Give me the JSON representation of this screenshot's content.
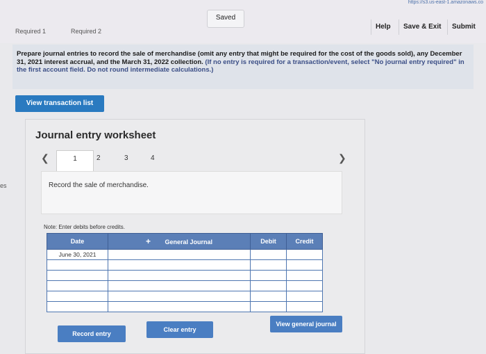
{
  "browser": {
    "url": "https://s3.us-east-1.amazonaws.co"
  },
  "header": {
    "saved_label": "Saved",
    "help_label": "Help",
    "save_exit_label": "Save & Exit",
    "submit_label": "Submit"
  },
  "tabs": [
    "Required 1",
    "Required 2"
  ],
  "prompt": {
    "instruction": "Prepare journal entries to record the sale of merchandise (omit any entry that might be required for the cost of the goods sold), any December 31, 2021 interest accrual, and the March 31, 2022 collection.",
    "hint": "(If no entry is required for a transaction/event, select \"No journal entry required\" in the first account field. Do not round intermediate calculations.)"
  },
  "view_transaction_list_label": "View transaction list",
  "side_cut_text": "es",
  "worksheet": {
    "title": "Journal entry worksheet",
    "prev_icon": "chevron-left-icon",
    "next_icon": "chevron-right-icon",
    "pages": [
      "1",
      "2",
      "3",
      "4"
    ],
    "active_page": "1",
    "description": "Record the sale of merchandise.",
    "note": "Note: Enter debits before credits.",
    "table": {
      "headers": {
        "date": "Date",
        "plus": "+",
        "account": "General Journal",
        "debit": "Debit",
        "credit": "Credit"
      },
      "rows": [
        {
          "date": "June 30, 2021",
          "account": "",
          "debit": "",
          "credit": ""
        },
        {
          "date": "",
          "account": "",
          "debit": "",
          "credit": ""
        },
        {
          "date": "",
          "account": "",
          "debit": "",
          "credit": ""
        },
        {
          "date": "",
          "account": "",
          "debit": "",
          "credit": ""
        },
        {
          "date": "",
          "account": "",
          "debit": "",
          "credit": ""
        },
        {
          "date": "",
          "account": "",
          "debit": "",
          "credit": ""
        }
      ]
    },
    "record_entry_label": "Record entry",
    "clear_entry_label": "Clear entry",
    "view_general_journal_label": "View general journal"
  }
}
